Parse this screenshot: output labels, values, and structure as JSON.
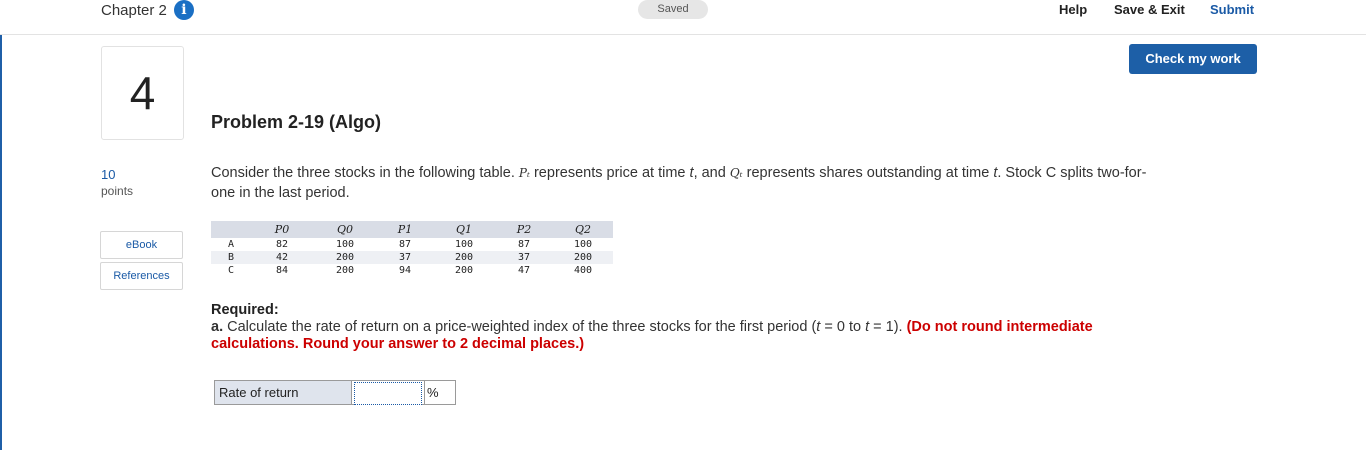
{
  "header": {
    "chapter": "Chapter 2",
    "info_icon": "i",
    "saved_status": "Saved",
    "help_label": "Help",
    "save_exit_label": "Save & Exit",
    "submit_label": "Submit",
    "check_label": "Check my work"
  },
  "question": {
    "number": "4",
    "title": "Problem 2-19 (Algo)",
    "points_value": "10",
    "points_label": "points"
  },
  "sidebar": {
    "ebook_label": "eBook",
    "references_label": "References"
  },
  "prompt": {
    "t1": "Consider the three stocks in the following table. ",
    "pt": "Pₜ",
    "t2": " represents price at time ",
    "t_var": "t",
    "t3": ", and ",
    "qt": "Qₜ",
    "t4": " represents shares outstanding at time ",
    "t_var2": "t",
    "t5": ". Stock C splits two-for-one in the last period."
  },
  "table": {
    "headers": [
      "",
      "P0",
      "Q0",
      "P1",
      "Q1",
      "P2",
      "Q2"
    ],
    "rows": [
      [
        "A",
        "82",
        "100",
        "87",
        "100",
        "87",
        "100"
      ],
      [
        "B",
        "42",
        "200",
        "37",
        "200",
        "37",
        "200"
      ],
      [
        "C",
        "84",
        "200",
        "94",
        "200",
        "47",
        "400"
      ]
    ]
  },
  "required": {
    "heading": "Required:",
    "part": "a.",
    "text1": " Calculate the rate of return on a price-weighted index of the three stocks for the first period (",
    "t_eq0": "t",
    "text2": " = 0 to ",
    "t_eq1": "t",
    "text3": " = 1). ",
    "instructions": "(Do not round intermediate calculations. Round your answer to 2 decimal places.)"
  },
  "answer": {
    "label": "Rate of return",
    "value": "",
    "unit": "%"
  },
  "colors": {
    "accent": "#1d5fa7",
    "instruction_red": "#cc0000",
    "table_header_bg": "#d9dde6"
  }
}
